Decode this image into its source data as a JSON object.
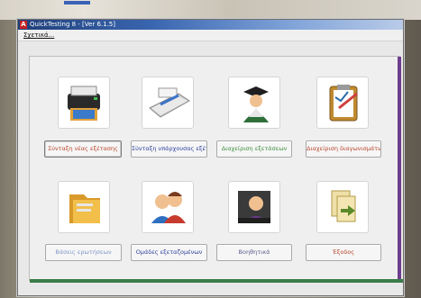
{
  "window": {
    "title": "QuickTesting 8 - [Ver 6.1.5]",
    "app_icon_letter": "A"
  },
  "menu": {
    "file_label": "Σχετικά..."
  },
  "tiles": [
    {
      "label": "Σύνταξη νέας εξέτασης",
      "icon": "printer-icon"
    },
    {
      "label": "Σύνταξη υπάρχουσας εξέτασης",
      "icon": "scanner-icon"
    },
    {
      "label": "Διαχείριση εξετάσεων",
      "icon": "graduate-icon"
    },
    {
      "label": "Διαχείριση διαγωνισμάτων",
      "icon": "clipboard-icon"
    },
    {
      "label": "Βάσεις ερωτήσεων",
      "icon": "folder-icon"
    },
    {
      "label": "Ομάδες εξεταζομένων",
      "icon": "people-icon"
    },
    {
      "label": "Βοηθητικά",
      "icon": "assistant-icon"
    },
    {
      "label": "Έξοδος",
      "icon": "exit-icon"
    }
  ],
  "colors": {
    "titlebar": "#2a4f94",
    "panel_right_accent": "#6d3d8f",
    "panel_bottom_accent": "#3a7c4a"
  }
}
